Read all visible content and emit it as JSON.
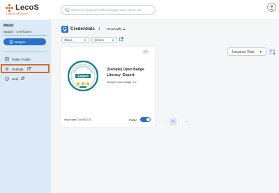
{
  "brand": {
    "name": "LecoS",
    "tagline": "Learn for the Future"
  },
  "search": {
    "placeholder": "Search by keyword, such as badge name, issuer, etc."
  },
  "sidebar": {
    "section_title": "Wallet",
    "breadcrumb": "Badges · Certificates",
    "active_item": "Badges",
    "items": [
      {
        "label": "Public Profile"
      },
      {
        "label": "Settings"
      },
      {
        "label": "Help"
      }
    ]
  },
  "main": {
    "title": "Credentials",
    "count": "1",
    "receivable_label": "Receivable",
    "filters": {
      "status_label": "Status",
      "version_label": "Version"
    },
    "sort_label": "Issuance Date"
  },
  "card": {
    "tag": "v1",
    "badge_name": "[Sample] Open Badge Literacy -Expert-",
    "issuer": "Sample Open Badge, Inc.",
    "badge_text": "Expert",
    "issue_date": "Issue date: 03/29/2023",
    "public_label": "Public",
    "public_on": true
  },
  "pagination": {
    "current": "1"
  },
  "colors": {
    "accent": "#2a70c9",
    "brand": "#e8541c",
    "highlight": "#d86a2a",
    "sidebar_bg": "#dce9f7"
  }
}
